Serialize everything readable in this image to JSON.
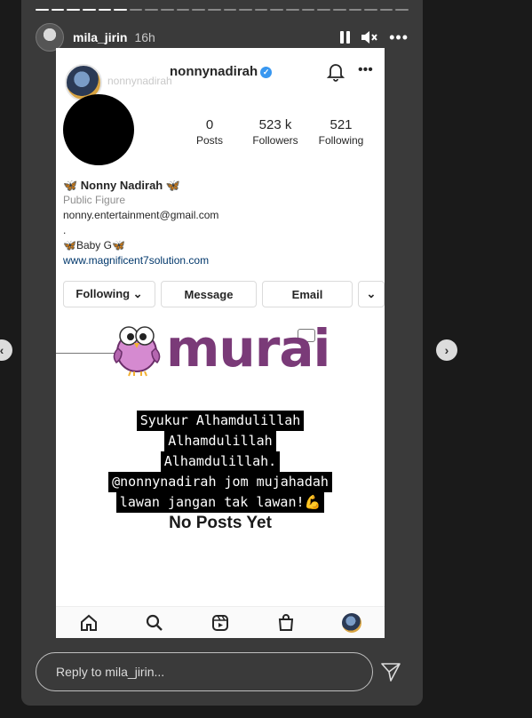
{
  "story": {
    "username": "mila_jirin",
    "time": "16h",
    "progress_segments_total": 24,
    "progress_segments_done": 6
  },
  "screenshot": {
    "ig_name": "nonnynadirah",
    "ghost_text": "nonnynadirah",
    "stats": [
      {
        "num": "0",
        "label": "Posts"
      },
      {
        "num": "523 k",
        "label": "Followers"
      },
      {
        "num": "521",
        "label": "Following"
      }
    ],
    "bio": {
      "display_name": "🦋 Nonny Nadirah 🦋",
      "category": "Public Figure",
      "email": "nonny.entertainment@gmail.com",
      "dot": ".",
      "baby": "🦋Baby G🦋",
      "link": "www.magnificent7solution.com"
    },
    "buttons": {
      "following": "Following ⌄",
      "message": "Message",
      "email": "Email",
      "dropdown": "⌄"
    },
    "logo_text": "murai",
    "caption_lines": [
      "Syukur Alhamdulillah",
      "Alhamdulillah",
      "Alhamdulillah.",
      "@nonnynadirah jom mujahadah",
      "lawan jangan tak lawan!💪"
    ],
    "no_posts": "No Posts Yet"
  },
  "reply": {
    "placeholder": "Reply to mila_jirin..."
  },
  "colors": {
    "logo_purple": "#7a3a78",
    "bird_pink": "#d58ad0",
    "verified_blue": "#3897f0"
  }
}
